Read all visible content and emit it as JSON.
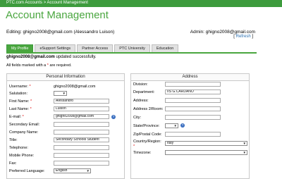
{
  "breadcrumb": {
    "root": "PTC.com Accounts",
    "separator": " > ",
    "current": "Account Management"
  },
  "page_title": "Account Management",
  "editing": {
    "label": "Editing:",
    "value": "ghigno2008@gmail.com (Alessandro Luison)"
  },
  "admin": {
    "label": "Admin:",
    "value": "ghigno2008@gmail.com",
    "refresh_open": "[ ",
    "refresh_label": "Refresh",
    "refresh_close": " ]"
  },
  "tabs": [
    {
      "label": "My Profile",
      "active": true
    },
    {
      "label": "eSupport Settings"
    },
    {
      "label": "Partner Access"
    },
    {
      "label": "PTC University"
    },
    {
      "label": "Education"
    }
  ],
  "messages": {
    "updated_email": "ghigno2008@gmail.com",
    "updated_text": " updated successfully.",
    "required_prefix": "All fields marked with a ",
    "required_star": "*",
    "required_suffix": " are required."
  },
  "personal": {
    "title": "Personal Information",
    "username_label": "Username:",
    "username_value": "ghigno2008@gmail.com",
    "salutation_label": "Salutation:",
    "salutation_value": "",
    "first_label": "First Name:",
    "first_value": "Alessandro",
    "last_label": "Last Name:",
    "last_value": "Luison",
    "email_label": "E-mail:",
    "email_value": "ghigno2008@gmail.com",
    "secondary_label": "Secondary Email:",
    "secondary_value": "",
    "company_label": "Company Name:",
    "company_value": "",
    "title_label": "Title:",
    "title_value": "Secondary Schools Student",
    "telephone_label": "Telephone:",
    "telephone_value": "",
    "mobile_label": "Mobile Phone:",
    "mobile_value": "",
    "fax_label": "Fax:",
    "fax_value": "",
    "language_label": "Preferred Language:",
    "language_value": "English"
  },
  "address": {
    "title": "Address",
    "division_label": "Division:",
    "division_value": "",
    "department_label": "Department:",
    "department_value": "IIS G.CARDANO",
    "address_label": "Address:",
    "address_value": "",
    "address2_label": "Address 2/Room:",
    "address2_value": "",
    "city_label": "City:",
    "city_value": "",
    "state_label": "State/Province:",
    "state_value": "",
    "zip_label": "Zip/Postal Code:",
    "zip_value": "",
    "country_label": "Country/Region:",
    "country_value": "Italy",
    "timezone_label": "Timezone:",
    "timezone_value": ""
  },
  "icons": {
    "help": "?",
    "dropdown": "▼",
    "required_star": "*"
  },
  "colors": {
    "brand_green": "#4aa63f",
    "link_blue": "#2a6fb0",
    "required_red": "#dd0000"
  }
}
